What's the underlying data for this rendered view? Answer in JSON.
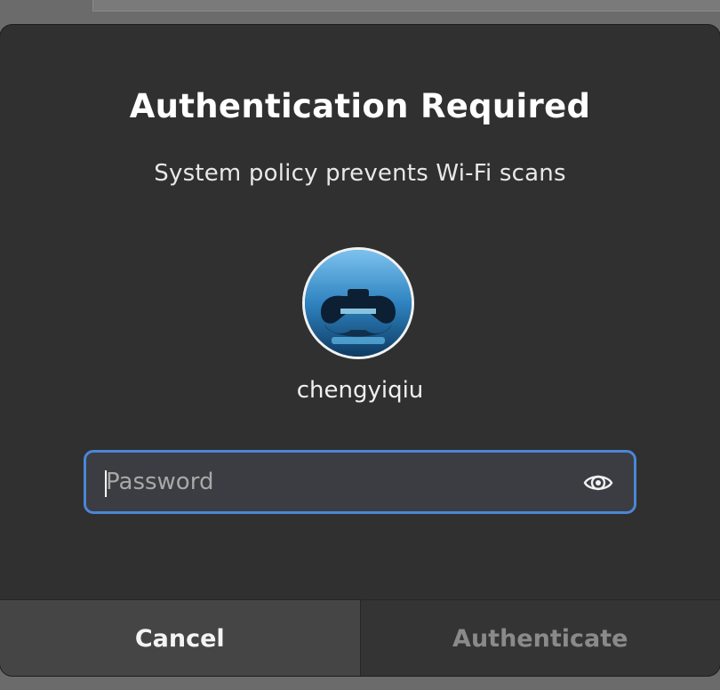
{
  "dialog": {
    "title": "Authentication Required",
    "message": "System policy prevents Wi-Fi scans",
    "user": {
      "name": "chengyiqiu",
      "avatar_icon": "gamepad-avatar"
    },
    "password": {
      "value": "",
      "placeholder": "Password",
      "reveal_icon": "eye-icon"
    },
    "buttons": {
      "cancel": "Cancel",
      "authenticate": "Authenticate"
    }
  },
  "colors": {
    "dialog_bg": "#303030",
    "focus_border": "#4a86d6",
    "field_bg": "#3b3d42",
    "cancel_bg": "#454545",
    "disabled_text": "#8a8a8a"
  }
}
